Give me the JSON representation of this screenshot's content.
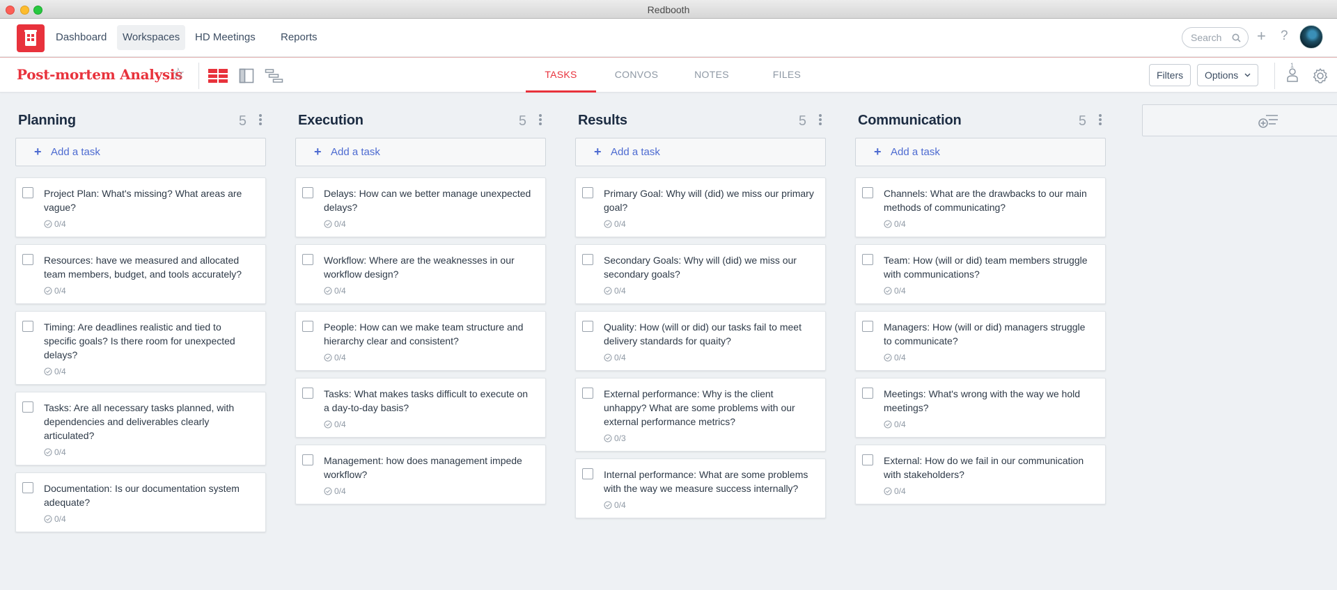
{
  "window": {
    "title": "Redbooth"
  },
  "topnav": {
    "items": [
      {
        "label": "Dashboard"
      },
      {
        "label": "Workspaces",
        "active": true
      },
      {
        "label": "HD Meetings"
      },
      {
        "label": "Reports"
      }
    ],
    "search_placeholder": "Search",
    "plus_glyph": "+",
    "help_glyph": "?"
  },
  "subbar": {
    "project_title": "Post-mortem Analysis",
    "tabs": [
      {
        "label": "TASKS",
        "active": true
      },
      {
        "label": "CONVOS"
      },
      {
        "label": "NOTES"
      },
      {
        "label": "FILES"
      }
    ],
    "filters_label": "Filters",
    "options_label": "Options",
    "people_count": "1"
  },
  "colors": {
    "brand": "#e8323c",
    "link": "#4d6bd1",
    "title": "#1c2c42"
  },
  "columns": [
    {
      "title": "Planning",
      "count": "5",
      "add_label": "Add a task",
      "tasks": [
        {
          "text": "Project Plan: What's missing? What areas are vague?",
          "progress": "0/4"
        },
        {
          "text": "Resources: have we measured and allocated team members, budget, and tools accurately?",
          "progress": "0/4"
        },
        {
          "text": "Timing: Are deadlines realistic and tied to specific goals? Is there room for unexpected delays?",
          "progress": "0/4"
        },
        {
          "text": "Tasks: Are all necessary tasks planned, with dependencies and deliverables clearly articulated?",
          "progress": "0/4"
        },
        {
          "text": "Documentation: Is our documentation system adequate?",
          "progress": "0/4"
        }
      ]
    },
    {
      "title": "Execution",
      "count": "5",
      "add_label": "Add a task",
      "tasks": [
        {
          "text": "Delays: How can we better manage unexpected delays?",
          "progress": "0/4"
        },
        {
          "text": "Workflow: Where are the weaknesses in our workflow design?",
          "progress": "0/4"
        },
        {
          "text": "People: How can we make team structure and hierarchy clear and consistent?",
          "progress": "0/4"
        },
        {
          "text": "Tasks: What makes tasks difficult to execute on a day-to-day basis?",
          "progress": "0/4"
        },
        {
          "text": "Management: how does management impede workflow?",
          "progress": "0/4"
        }
      ]
    },
    {
      "title": "Results",
      "count": "5",
      "add_label": "Add a task",
      "tasks": [
        {
          "text": "Primary Goal: Why will (did) we miss our primary goal?",
          "progress": "0/4"
        },
        {
          "text": "Secondary Goals: Why will (did) we miss our secondary goals?",
          "progress": "0/4"
        },
        {
          "text": "Quality: How (will or did) our tasks fail to meet delivery standards for quaity?",
          "progress": "0/4"
        },
        {
          "text": "External performance: Why is the client unhappy? What are some problems with our external performance metrics?",
          "progress": "0/3"
        },
        {
          "text": "Internal performance: What are some problems with the way we measure success internally?",
          "progress": "0/4"
        }
      ]
    },
    {
      "title": "Communication",
      "count": "5",
      "add_label": "Add a task",
      "tasks": [
        {
          "text": "Channels: What are the drawbacks to our main methods of communicating?",
          "progress": "0/4"
        },
        {
          "text": "Team: How (will or did) team members struggle with communications?",
          "progress": "0/4"
        },
        {
          "text": "Managers: How (will or did) managers struggle to communicate?",
          "progress": "0/4"
        },
        {
          "text": "Meetings: What's wrong with the way we hold meetings?",
          "progress": "0/4"
        },
        {
          "text": "External: How do we fail in our communication with stakeholders?",
          "progress": "0/4"
        }
      ]
    }
  ]
}
